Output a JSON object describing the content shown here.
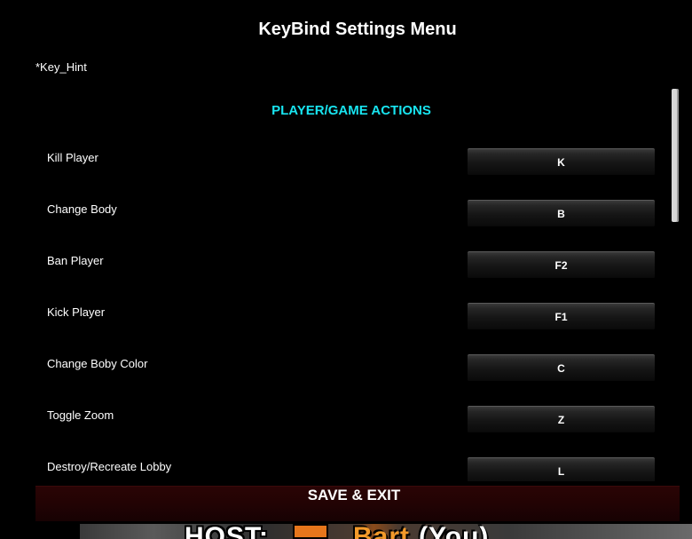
{
  "menu": {
    "title": "KeyBind Settings Menu",
    "hint": "*Key_Hint",
    "section_header": "PLAYER/GAME ACTIONS",
    "section_color": "#18e4f0",
    "bindings": [
      {
        "action": "Kill Player",
        "key": "K"
      },
      {
        "action": "Change Body",
        "key": "B"
      },
      {
        "action": "Ban Player",
        "key": "F2"
      },
      {
        "action": "Kick Player",
        "key": "F1"
      },
      {
        "action": "Change Boby Color",
        "key": "C"
      },
      {
        "action": "Toggle Zoom",
        "key": "Z"
      },
      {
        "action": "Destroy/Recreate Lobby",
        "key": "L"
      }
    ],
    "save_label": "SAVE & EXIT",
    "save_color": "#220304"
  },
  "background_game": {
    "left_text": "HOST:",
    "name_text": "Bart",
    "suffix_text": "(You)",
    "name_color": "#f39a2a"
  }
}
